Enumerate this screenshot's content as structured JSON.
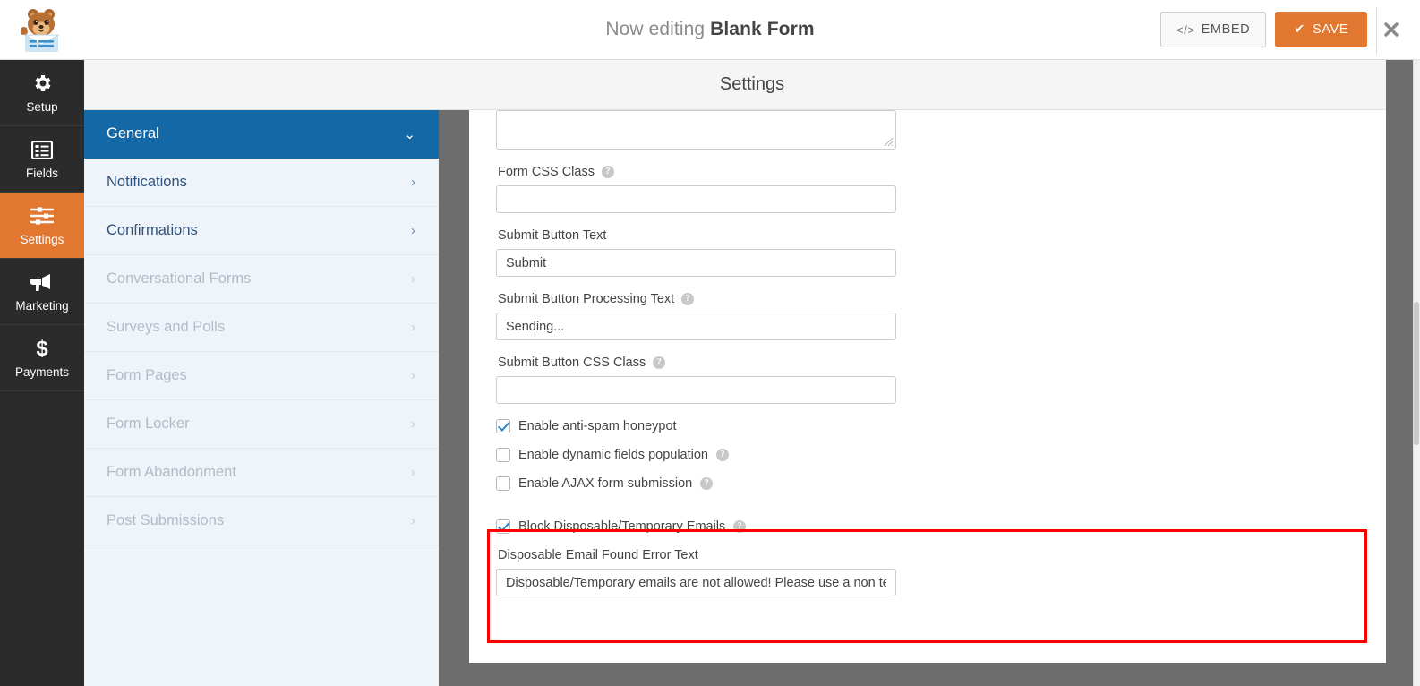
{
  "topbar": {
    "logo_name": "wpforms-bear-logo",
    "editing_prefix": "Now editing ",
    "form_name": "Blank Form",
    "embed_label": "EMBED",
    "embed_icon": "</>",
    "save_label": "SAVE",
    "save_icon": "✔",
    "close_icon": "✖",
    "save_color": "#e27730"
  },
  "rail": {
    "items": [
      {
        "label": "Setup",
        "icon": "gear-icon",
        "active": false
      },
      {
        "label": "Fields",
        "icon": "list-icon",
        "active": false
      },
      {
        "label": "Settings",
        "icon": "sliders-icon",
        "active": true
      },
      {
        "label": "Marketing",
        "icon": "megaphone-icon",
        "active": false
      },
      {
        "label": "Payments",
        "icon": "dollar-icon",
        "active": false
      }
    ]
  },
  "settings_header": {
    "title": "Settings"
  },
  "nav": {
    "items": [
      {
        "label": "General",
        "state": "active",
        "chevron": "⌄"
      },
      {
        "label": "Notifications",
        "state": "enabled",
        "chevron": "›"
      },
      {
        "label": "Confirmations",
        "state": "enabled",
        "chevron": "›"
      },
      {
        "label": "Conversational Forms",
        "state": "disabled",
        "chevron": "›"
      },
      {
        "label": "Surveys and Polls",
        "state": "disabled",
        "chevron": "›"
      },
      {
        "label": "Form Pages",
        "state": "disabled",
        "chevron": "›"
      },
      {
        "label": "Form Locker",
        "state": "disabled",
        "chevron": "›"
      },
      {
        "label": "Form Abandonment",
        "state": "disabled",
        "chevron": "›"
      },
      {
        "label": "Post Submissions",
        "state": "disabled",
        "chevron": "›"
      }
    ],
    "active_color": "#1368a5"
  },
  "form": {
    "textarea_top": {
      "value": "",
      "has_resize_handle": true
    },
    "fields": [
      {
        "label": "Form CSS Class",
        "help": true,
        "value": ""
      },
      {
        "label": "Submit Button Text",
        "help": false,
        "value": "Submit"
      },
      {
        "label": "Submit Button Processing Text",
        "help": true,
        "value": "Sending..."
      },
      {
        "label": "Submit Button CSS Class",
        "help": true,
        "value": ""
      }
    ],
    "checkboxes": [
      {
        "label": "Enable anti-spam honeypot",
        "checked": true,
        "help": false
      },
      {
        "label": "Enable dynamic fields population",
        "checked": false,
        "help": true
      },
      {
        "label": "Enable AJAX form submission",
        "checked": false,
        "help": true
      }
    ],
    "highlighted": {
      "border_color": "#ff0000",
      "checkbox": {
        "label": "Block Disposable/Temporary Emails",
        "checked": true,
        "help": true
      },
      "error_field": {
        "label": "Disposable Email Found Error Text",
        "value": "Disposable/Temporary emails are not allowed! Please use a non tempo"
      }
    }
  }
}
